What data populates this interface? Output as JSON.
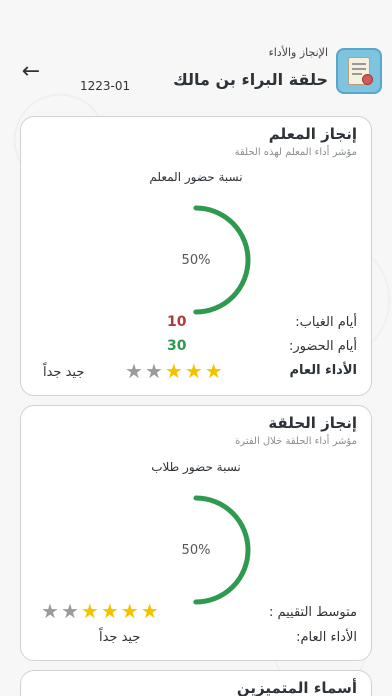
{
  "header": {
    "subtitle": "الإنجاز والأداء",
    "title": "حلقة البراء بن مالك",
    "code": "1223-01",
    "back_icon": "arrow-left-icon",
    "logo_icon": "certificate-icon"
  },
  "teacher_card": {
    "title": "إنجاز المعلم",
    "subtitle": "مؤشر أداء المعلم لهذه الحلقة",
    "gauge_label": "نسبة حضور المعلم",
    "gauge_percent_text": "50%",
    "gauge_fraction": 0.5,
    "absence_label": "أيام الغياب:",
    "absence_value": "10",
    "attendance_label": "أيام الحضور:",
    "attendance_value": "30",
    "performance_label": "الأداء العام",
    "performance_text": "جيد جداً",
    "stars_filled": 3,
    "stars_total": 5
  },
  "circle_card": {
    "title": "إنجاز الحلقة",
    "subtitle": "مؤشر أداء الحلقة خلال الفترة",
    "gauge_label": "نسبة حضور طلاب",
    "gauge_percent_text": "50%",
    "gauge_fraction": 0.5,
    "avg_rating_label": "متوسط التقييم :",
    "stars_filled": 4,
    "stars_total": 6,
    "performance_label": "الأداء العام:",
    "performance_text": "جيد جداً"
  },
  "excellent_card": {
    "title": "أسماء المتميزين"
  },
  "colors": {
    "gauge_green": "#2e9a4f",
    "absence_red": "#b23a3a",
    "attendance_green": "#2e9a4f",
    "star_gold": "#f2c400",
    "star_gray": "#9b9b9b"
  }
}
